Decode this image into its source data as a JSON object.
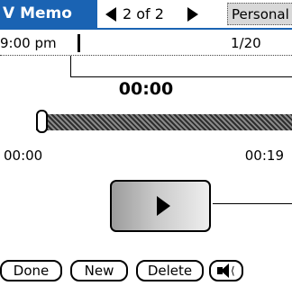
{
  "header": {
    "app_title": "V Memo",
    "page_indicator": "2 of 2",
    "category": "Personal"
  },
  "memo": {
    "time_label": "9:00 pm",
    "count": "1/20"
  },
  "player": {
    "elapsed": "00:00",
    "start_time": "00:00",
    "end_time": "00:19",
    "progress": 0.0
  },
  "buttons": {
    "done": "Done",
    "new": "New",
    "delete": "Delete"
  },
  "icons": {
    "prev": "left-triangle-icon",
    "next": "right-triangle-icon",
    "play": "play-icon",
    "speaker": "speaker-icon"
  }
}
